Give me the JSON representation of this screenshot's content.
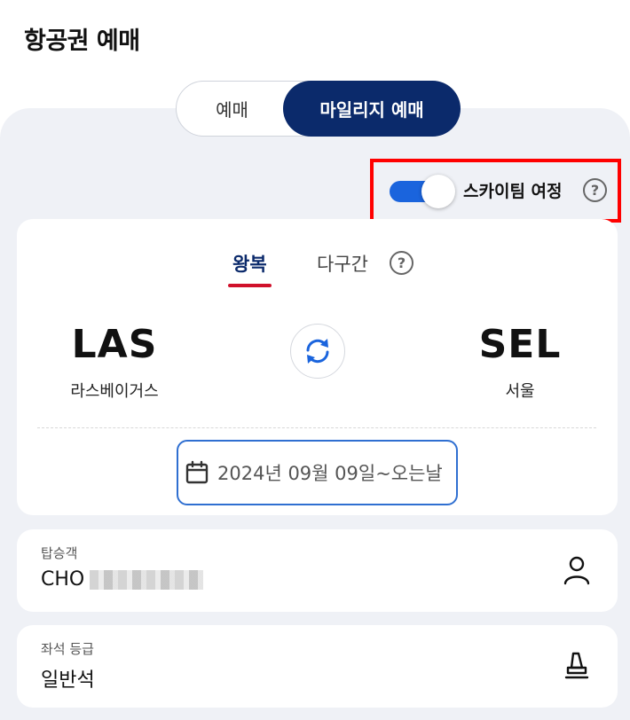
{
  "header": {
    "title": "항공권 예매"
  },
  "mode_toggle": {
    "normal_label": "예매",
    "mileage_label": "마일리지 예매"
  },
  "skyteam": {
    "label": "스카이팀 여정",
    "help": "?"
  },
  "trip": {
    "tabs": [
      {
        "label": "왕복"
      },
      {
        "label": "다구간"
      }
    ],
    "help": "?",
    "origin": {
      "code": "LAS",
      "name": "라스베이거스"
    },
    "destination": {
      "code": "SEL",
      "name": "서울"
    },
    "date": "2024년 09월 09일~오는날"
  },
  "passenger": {
    "label": "탑승객",
    "value": "CHO"
  },
  "seat_class": {
    "label": "좌석 등급",
    "value": "일반석"
  },
  "colors": {
    "brand_navy": "#0b2a6b",
    "accent_blue": "#1a64dd",
    "tab_underline_red": "#d0112b",
    "highlight_red": "#ff0000"
  },
  "icons": [
    "help-icon",
    "swap-icon",
    "calendar-icon",
    "person-icon",
    "seat-icon"
  ]
}
